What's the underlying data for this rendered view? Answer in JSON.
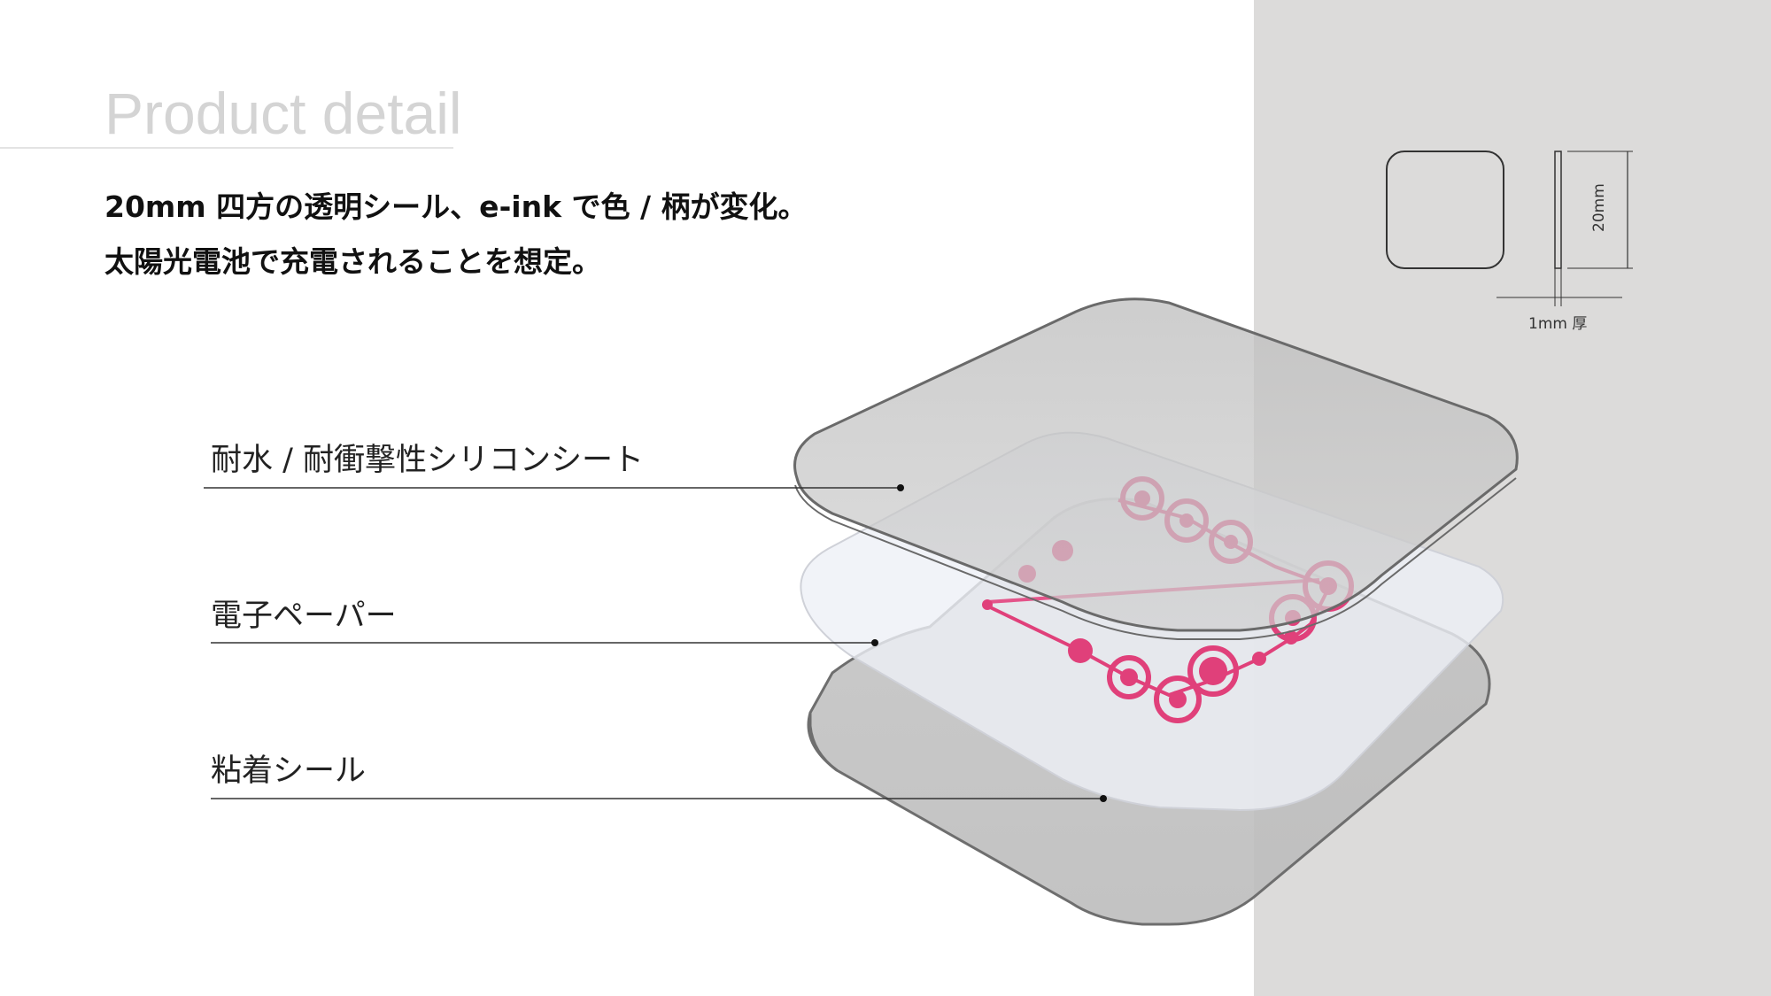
{
  "header": {
    "title": "Product detail"
  },
  "description": {
    "line1": "20mm 四方の透明シール、e-ink で色 / 柄が変化。",
    "line2": "太陽光電池で充電されることを想定。"
  },
  "layers": [
    {
      "label": "耐水 / 耐衝撃性シリコンシート"
    },
    {
      "label": "電子ペーパー"
    },
    {
      "label": "粘着シール"
    }
  ],
  "dimensions": {
    "height_label": "20mm",
    "thickness_label": "1mm 厚"
  },
  "colors": {
    "panel_background": "#dcdbda",
    "title_color": "#d4d4d4",
    "pattern_pink": "#e0407a"
  }
}
